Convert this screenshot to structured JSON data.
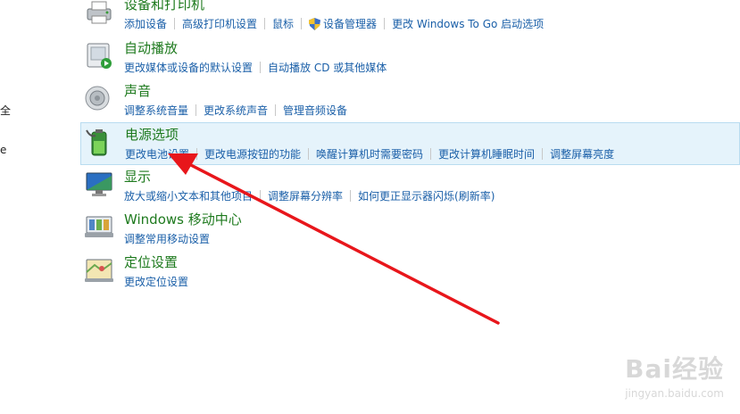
{
  "left_fragments": [
    "全",
    "e"
  ],
  "categories": [
    {
      "title": "设备和打印机",
      "links": [
        "添加设备",
        "高级打印机设置",
        "鼠标",
        "设备管理器",
        "更改 Windows To Go 启动选项"
      ]
    },
    {
      "title": "自动播放",
      "links": [
        "更改媒体或设备的默认设置",
        "自动播放 CD 或其他媒体"
      ]
    },
    {
      "title": "声音",
      "links": [
        "调整系统音量",
        "更改系统声音",
        "管理音频设备"
      ]
    },
    {
      "title": "电源选项",
      "links": [
        "更改电池设置",
        "更改电源按钮的功能",
        "唤醒计算机时需要密码",
        "更改计算机睡眠时间",
        "调整屏幕亮度"
      ]
    },
    {
      "title": "显示",
      "links": [
        "放大或缩小文本和其他项目",
        "调整屏幕分辨率",
        "如何更正显示器闪烁(刷新率)"
      ]
    },
    {
      "title": "Windows 移动中心",
      "links": [
        "调整常用移动设置"
      ]
    },
    {
      "title": "定位设置",
      "links": [
        "更改定位设置"
      ]
    }
  ],
  "watermark": {
    "main": "Bai经验",
    "sub": "jingyan.baidu.com"
  },
  "colors": {
    "title": "#1e7a1e",
    "link": "#1a5fa8",
    "highlight_bg": "#e5f3fb",
    "arrow": "#e8161b"
  },
  "icons": [
    "printer-icon",
    "autoplay-icon",
    "speaker-icon",
    "battery-icon",
    "monitor-icon",
    "mobility-center-icon",
    "location-icon"
  ]
}
